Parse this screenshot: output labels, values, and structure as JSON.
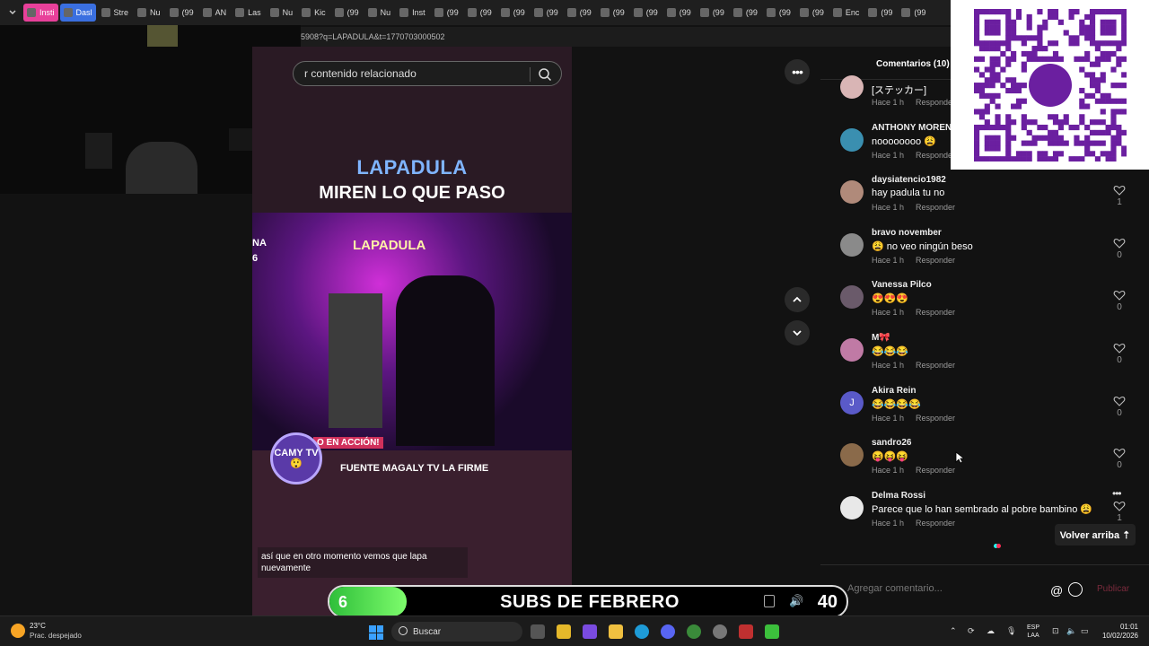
{
  "browser": {
    "tabs": [
      {
        "label": "Insti",
        "style": "pink"
      },
      {
        "label": "Dasl",
        "style": "blue"
      },
      {
        "label": "Stre",
        "style": ""
      },
      {
        "label": "Nu",
        "style": ""
      },
      {
        "label": "(99",
        "style": ""
      },
      {
        "label": "AN",
        "style": ""
      },
      {
        "label": "Las",
        "style": ""
      },
      {
        "label": "Nu",
        "style": ""
      },
      {
        "label": "Kic",
        "style": ""
      },
      {
        "label": "(99",
        "style": ""
      },
      {
        "label": "Nu",
        "style": ""
      },
      {
        "label": "Inst",
        "style": ""
      },
      {
        "label": "(99",
        "style": ""
      },
      {
        "label": "(99",
        "style": ""
      },
      {
        "label": "(99",
        "style": ""
      },
      {
        "label": "(99",
        "style": ""
      },
      {
        "label": "(99",
        "style": ""
      },
      {
        "label": "(99",
        "style": ""
      },
      {
        "label": "(99",
        "style": ""
      },
      {
        "label": "(99",
        "style": ""
      },
      {
        "label": "(99",
        "style": ""
      },
      {
        "label": "(99",
        "style": ""
      },
      {
        "label": "(99",
        "style": ""
      },
      {
        "label": "(99",
        "style": ""
      },
      {
        "label": "Enc",
        "style": ""
      },
      {
        "label": "(99",
        "style": ""
      },
      {
        "label": "(99",
        "style": ""
      }
    ],
    "url": "5908?q=LAPADULA&t=1770703000502"
  },
  "video": {
    "search_placeholder": "r contenido relacionado",
    "title_line1": "LAPADULA",
    "title_line2": "MIREN LO QUE PASO",
    "clip_label": "LAPADULA",
    "edge_text1": "NA",
    "edge_text2": "6",
    "accion_label": "O EN ACCIÓN!",
    "badge_text": "CAMY TV 😲",
    "fuente": "FUENTE MAGALY TV LA FIRME",
    "subtitle": "así que en otro momento vemos que lapa nuevamente"
  },
  "comments": {
    "header": "Comentarios (10)",
    "list": [
      {
        "user": "",
        "text": "[ステッカー]",
        "time": "Hace 1 h",
        "reply": "Responder",
        "likes": "",
        "avatar_color": "#d9b5b5",
        "avatar_letter": ""
      },
      {
        "user": "ANTHONY MORENO",
        "text": "noooooooo 😩",
        "time": "Hace 1 h",
        "reply": "Responder",
        "likes": "",
        "avatar_color": "#3a8fb0",
        "avatar_letter": ""
      },
      {
        "user": "daysiatencio1982",
        "text": "hay padula tu no",
        "time": "Hace 1 h",
        "reply": "Responder",
        "likes": "1",
        "avatar_color": "#b08a7a",
        "avatar_letter": ""
      },
      {
        "user": "bravo november",
        "text": "😩 no veo ningún beso",
        "time": "Hace 1 h",
        "reply": "Responder",
        "likes": "0",
        "avatar_color": "#8a8a8a",
        "avatar_letter": ""
      },
      {
        "user": "Vanessa Pilco",
        "text": "😍😍😍",
        "time": "Hace 1 h",
        "reply": "Responder",
        "likes": "0",
        "avatar_color": "#6a5a6a",
        "avatar_letter": ""
      },
      {
        "user": "M🎀",
        "text": "😂😂😂",
        "time": "Hace 1 h",
        "reply": "Responder",
        "likes": "0",
        "avatar_color": "#c07aa5",
        "avatar_letter": ""
      },
      {
        "user": "Akira Rein",
        "text": "😂😂😂😂",
        "time": "Hace 1 h",
        "reply": "Responder",
        "likes": "0",
        "avatar_color": "#5a5ac8",
        "avatar_letter": "J"
      },
      {
        "user": "sandro26",
        "text": "😝😝😝",
        "time": "Hace 1 h",
        "reply": "Responder",
        "likes": "0",
        "avatar_color": "#8a6a4a",
        "avatar_letter": ""
      },
      {
        "user": "Delma Rossi",
        "text": "Parece que lo han sembrado al pobre bambino 😩",
        "time": "Hace 1 h",
        "reply": "Responder",
        "likes": "1",
        "avatar_color": "#e8e8e8",
        "avatar_letter": ""
      }
    ],
    "back_top": "Volver arriba ⇡",
    "input_placeholder": "Agregar comentario...",
    "publish": "Publicar"
  },
  "subs": {
    "current": "6",
    "label": "SUBS DE FEBRERO",
    "goal": "40",
    "progress": 0.15
  },
  "taskbar": {
    "temperature": "23°C",
    "condition": "Prac. despejado",
    "search": "Buscar",
    "lang_line1": "ESP",
    "lang_line2": "LAA",
    "time": "01:01",
    "date": "10/02/2026"
  }
}
